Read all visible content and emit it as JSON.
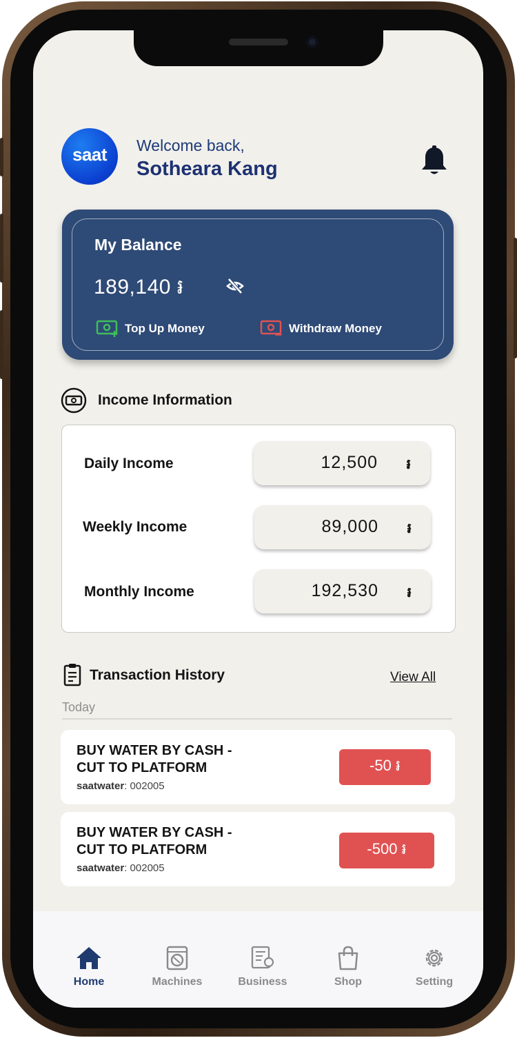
{
  "header": {
    "logo_text": "saat",
    "welcome": "Welcome back,",
    "username": "Sotheara Kang"
  },
  "balance": {
    "title": "My Balance",
    "amount": "189,140 ៛",
    "top_up_label": "Top Up Money",
    "withdraw_label": "Withdraw Money"
  },
  "income": {
    "title": "Income Information",
    "rows": [
      {
        "label": "Daily Income",
        "value": "12,500",
        "currency": "៛"
      },
      {
        "label": "Weekly Income",
        "value": "89,000",
        "currency": "៛"
      },
      {
        "label": "Monthly Income",
        "value": "192,530",
        "currency": "៛"
      }
    ]
  },
  "transactions": {
    "title": "Transaction History",
    "view_all": "View All",
    "group_label": "Today",
    "items": [
      {
        "title": "BUY WATER BY CASH - CUT TO PLATFORM",
        "ref_label": "saatwater",
        "ref_value": ": 002005",
        "amount": "-50 ៛"
      },
      {
        "title": "BUY WATER BY CASH - CUT TO PLATFORM",
        "ref_label": "saatwater",
        "ref_value": ": 002005",
        "amount": "-500 ៛"
      }
    ]
  },
  "nav": {
    "items": [
      {
        "label": "Home",
        "icon": "home-icon",
        "active": true
      },
      {
        "label": "Machines",
        "icon": "washing-machine-icon",
        "active": false
      },
      {
        "label": "Business",
        "icon": "business-report-icon",
        "active": false
      },
      {
        "label": "Shop",
        "icon": "shopping-bag-icon",
        "active": false
      },
      {
        "label": "Setting",
        "icon": "gear-icon",
        "active": false
      }
    ]
  },
  "colors": {
    "primary": "#2e4a76",
    "top_up_green": "#3fbf5a",
    "withdraw_red": "#e05252",
    "background": "#f1f0eb"
  }
}
